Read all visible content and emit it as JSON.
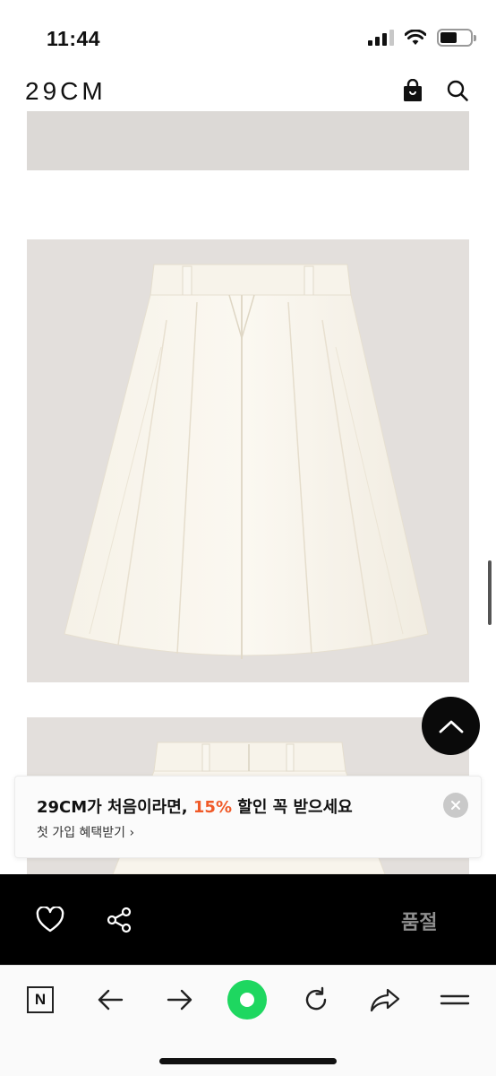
{
  "status_bar": {
    "time": "11:44"
  },
  "header": {
    "logo": "29CM"
  },
  "promo": {
    "title_before": "29CM가 처음이라면, ",
    "title_accent": "15%",
    "title_after": " 할인 꼭 받으세요",
    "subtitle": "첫 가입 혜택받기",
    "accent_color": "#f05a28"
  },
  "action_bar": {
    "status_label": "품절"
  },
  "browser_bar": {
    "n_label": "N"
  },
  "icons": {
    "bag": "shopping-bag-icon",
    "search": "search-icon",
    "scroll_top": "chevron-up-icon",
    "close": "close-icon",
    "heart": "heart-icon",
    "share": "share-icon",
    "back": "arrow-left-icon",
    "forward": "arrow-right-icon",
    "reload": "reload-icon",
    "share_out": "share-arrow-icon",
    "menu": "menu-icon"
  }
}
